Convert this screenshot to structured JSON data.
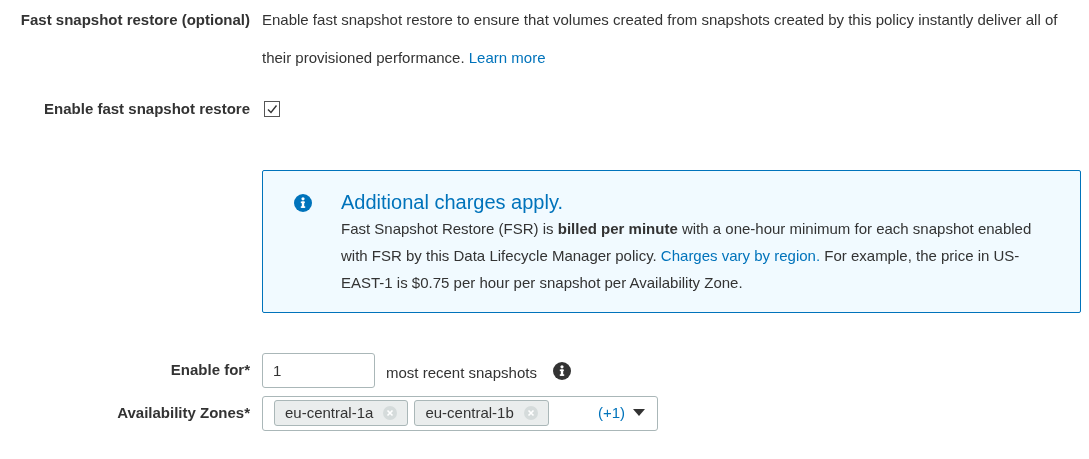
{
  "fast_snapshot_restore": {
    "label": "Fast snapshot restore (optional)",
    "description": "Enable fast snapshot restore to ensure that volumes created from snapshots created by this policy instantly deliver all of their provisioned performance.",
    "link": "Learn more"
  },
  "enable_checkbox": {
    "label": "Enable fast snapshot restore",
    "checked": true
  },
  "alert": {
    "title": "Additional charges apply.",
    "text_before": "Fast Snapshot Restore (FSR) is **billed per minute** with a one-hour minimum for each snapshot enabled with FSR by this Data Lifecycle Manager policy.",
    "link": "Charges vary by region.",
    "text_after": "For example, the price in US-EAST-1 is $0.75 per hour per snapshot per Availability Zone."
  },
  "enable_for": {
    "label": "Enable for*",
    "value": "1",
    "suffix": "most recent snapshots"
  },
  "availability_zones": {
    "label": "Availability Zones*",
    "tokens": [
      "eu-central-1a",
      "eu-central-1b"
    ],
    "more": "(+1)"
  }
}
